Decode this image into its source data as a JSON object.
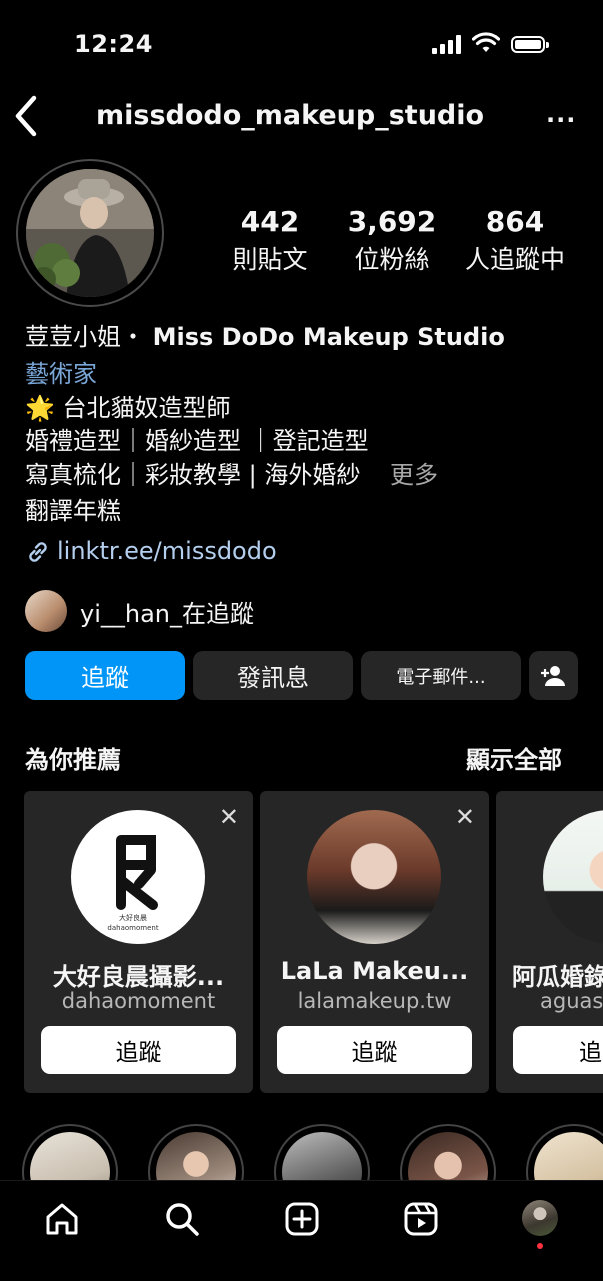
{
  "status_bar": {
    "time": "12:24"
  },
  "header": {
    "username": "missdodo_makeup_studio",
    "more": "···"
  },
  "stats": [
    {
      "value": "442",
      "label": "則貼文"
    },
    {
      "value": "3,692",
      "label": "位粉絲"
    },
    {
      "value": "864",
      "label": "人追蹤中"
    }
  ],
  "bio": {
    "name_cn": "荳荳小姐・",
    "name_en": "Miss DoDo Makeup Studio",
    "category": "藝術家",
    "line1": "🌟 台北貓奴造型師",
    "line2": "婚禮造型｜婚紗造型 ｜登記造型",
    "line3": "寫真梳化｜彩妝教學 | 海外婚紗",
    "more": "更多",
    "line4": "翻譯年糕",
    "link": "linktr.ee/missdodo"
  },
  "followed_by": {
    "text": "yi__han_在追蹤"
  },
  "actions": {
    "follow": "追蹤",
    "message": "發訊息",
    "email": "電子郵件...",
    "add_user_icon": "add-user-icon"
  },
  "suggested": {
    "title": "為你推薦",
    "see_all": "顯示全部",
    "cards": [
      {
        "name": "大好良晨攝影...",
        "handle": "dahaomoment",
        "button": "追蹤",
        "logo_text": "大好良晨",
        "logo_sub": "dahaomoment"
      },
      {
        "name": "LaLa Makeu...",
        "handle": "lalamakeup.tw",
        "button": "追蹤"
      },
      {
        "name": "阿瓜婚錄",
        "handle": "aguas",
        "button": "追"
      }
    ]
  },
  "nav": [
    "home-icon",
    "search-icon",
    "create-icon",
    "reels-icon",
    "profile-avatar"
  ]
}
